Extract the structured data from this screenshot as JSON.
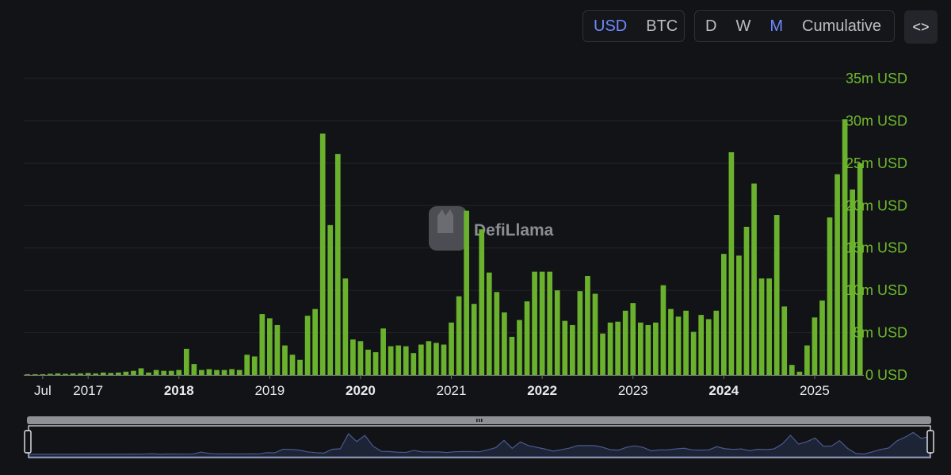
{
  "toolbar": {
    "currency_options": [
      "USD",
      "BTC"
    ],
    "currency_active": "USD",
    "period_options": [
      "D",
      "W",
      "M",
      "Cumulative"
    ],
    "period_active": "M",
    "embed_label": "<>"
  },
  "watermark": "DefiLlama",
  "colors": {
    "background": "#121316",
    "bar": "#6ab12e",
    "axis_label": "#6fba2d",
    "active_option": "#6e89ff",
    "brush_line": "#4a5a8f",
    "brush_fill": "#1d2436"
  },
  "chart_data": {
    "type": "bar",
    "interval": "monthly",
    "x_start": "2016-05",
    "yunit": "USD",
    "ylim": [
      0,
      35
    ],
    "y_ticks": [
      "0 USD",
      "5m USD",
      "10m USD",
      "15m USD",
      "20m USD",
      "25m USD",
      "30m USD",
      "35m USD"
    ],
    "x_tick_labels": [
      {
        "label": "Jul",
        "date": "2016-07",
        "bold": false
      },
      {
        "label": "2017",
        "date": "2017-01",
        "bold": false
      },
      {
        "label": "2018",
        "date": "2018-01",
        "bold": true
      },
      {
        "label": "2019",
        "date": "2019-01",
        "bold": false
      },
      {
        "label": "2020",
        "date": "2020-01",
        "bold": true
      },
      {
        "label": "2021",
        "date": "2021-01",
        "bold": false
      },
      {
        "label": "2022",
        "date": "2022-01",
        "bold": true
      },
      {
        "label": "2023",
        "date": "2023-01",
        "bold": false
      },
      {
        "label": "2024",
        "date": "2024-01",
        "bold": true
      },
      {
        "label": "2025",
        "date": "2025-01",
        "bold": false
      }
    ],
    "grid": true,
    "brush_zoom": true,
    "values": [
      0.1,
      0.1,
      0.1,
      0.15,
      0.2,
      0.15,
      0.2,
      0.2,
      0.25,
      0.2,
      0.3,
      0.25,
      0.3,
      0.4,
      0.5,
      0.8,
      0.3,
      0.6,
      0.5,
      0.5,
      0.6,
      3.1,
      1.3,
      0.6,
      0.7,
      0.6,
      0.6,
      0.7,
      0.6,
      2.4,
      2.2,
      7.2,
      6.7,
      5.9,
      3.5,
      2.4,
      1.8,
      7.0,
      7.8,
      28.5,
      17.7,
      26.1,
      11.4,
      4.2,
      4.0,
      3.0,
      2.7,
      5.5,
      3.4,
      3.5,
      3.4,
      2.6,
      3.6,
      4.0,
      3.8,
      3.6,
      6.2,
      9.3,
      19.4,
      8.4,
      17.2,
      12.1,
      9.8,
      7.4,
      4.5,
      6.5,
      8.7,
      12.2,
      12.2,
      12.2,
      10.0,
      6.4,
      5.9,
      9.9,
      11.7,
      9.6,
      4.9,
      6.2,
      6.3,
      7.6,
      8.5,
      6.2,
      5.9,
      6.2,
      10.6,
      7.8,
      6.9,
      7.6,
      5.1,
      7.1,
      6.6,
      7.6,
      14.3,
      26.3,
      14.1,
      17.5,
      22.6,
      11.4,
      11.4,
      18.9,
      8.1,
      1.2,
      0.4,
      3.5,
      6.8,
      8.8,
      18.6,
      23.7,
      30.2,
      21.9,
      25.0
    ]
  }
}
